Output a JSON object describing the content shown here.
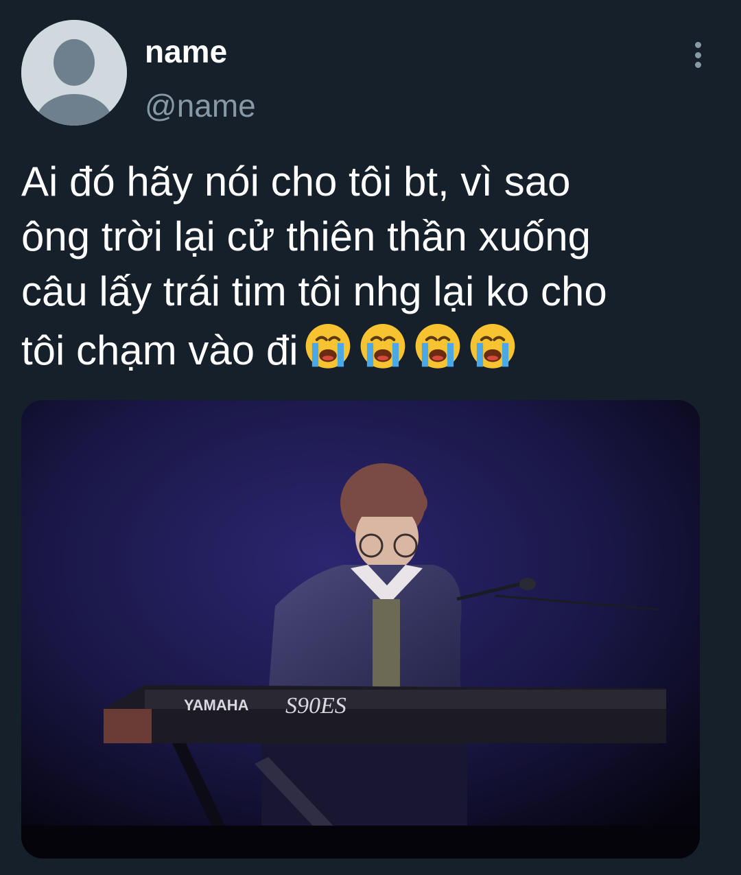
{
  "tweet": {
    "author": {
      "display_name": "name",
      "handle": "@name",
      "avatar": "default-profile-icon"
    },
    "more_icon": "more-vertical-icon",
    "text": "Ai đó hãy nói cho tôi bt, vì sao\nông trời lại cử thiên thần xuống\ncâu lấy trái tim tôi nhg lại ko cho\ntôi chạm vào đi",
    "emojis": [
      "loudly-crying-face",
      "loudly-crying-face",
      "loudly-crying-face",
      "loudly-crying-face"
    ],
    "media": {
      "description_icon": "photo",
      "keyboard_brand": "YAMAHA",
      "keyboard_model": "S90ES"
    }
  },
  "colors": {
    "background": "#15202b",
    "text_primary": "#ffffff",
    "text_secondary": "#8899a6",
    "avatar_bg": "#cfd9de"
  }
}
